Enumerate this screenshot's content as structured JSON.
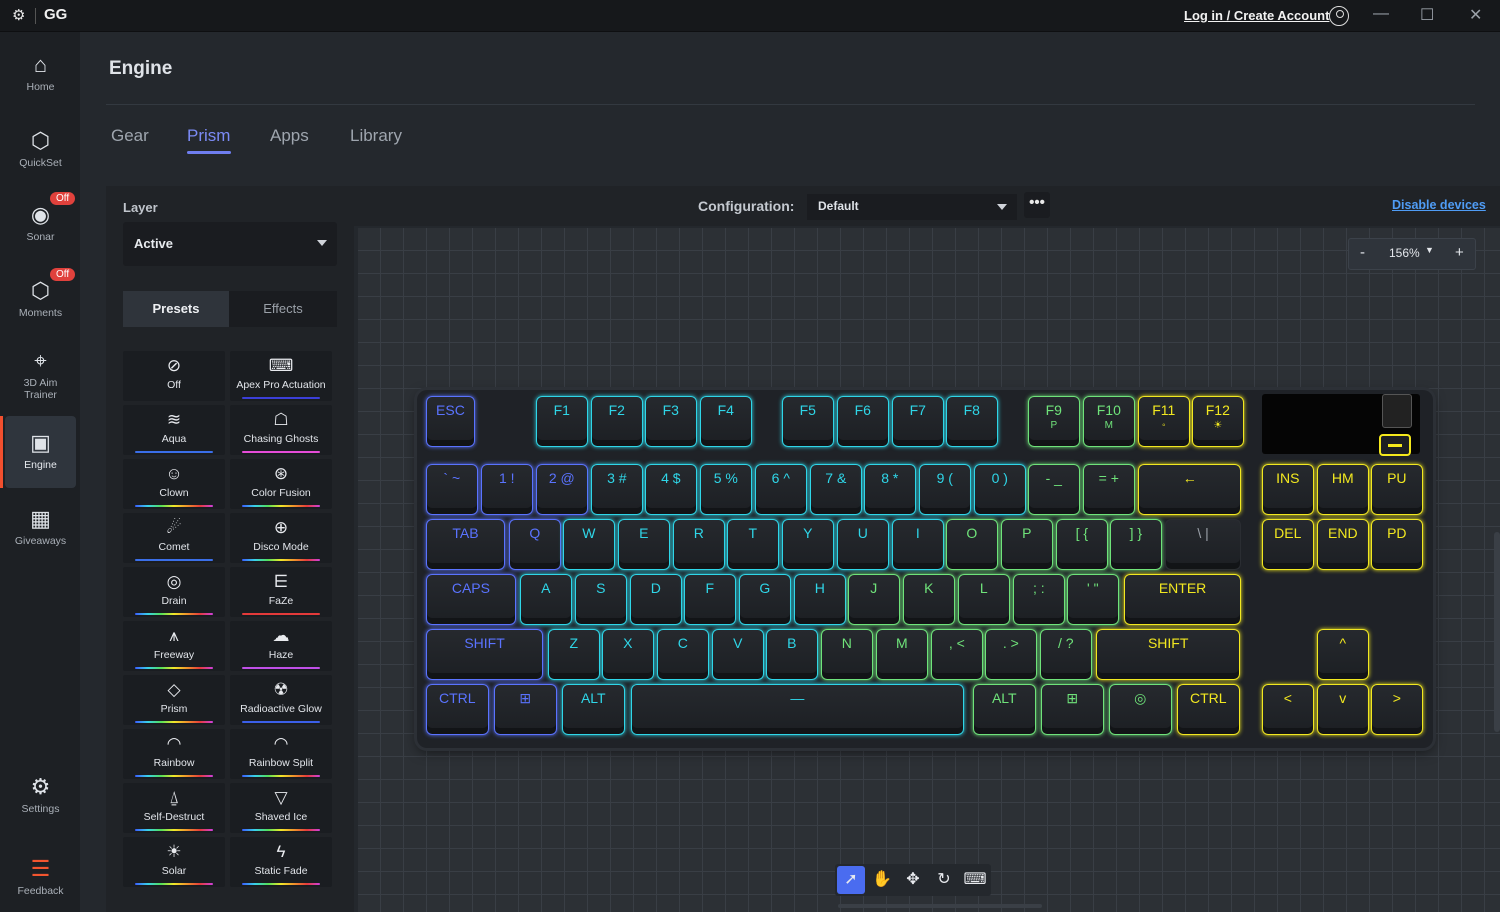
{
  "titlebar": {
    "app": "GG",
    "login": "Log in / Create Account"
  },
  "sidebar": {
    "items": [
      {
        "label": "Home",
        "icon": "home-icon"
      },
      {
        "label": "QuickSet",
        "icon": "quickset-icon"
      },
      {
        "label": "Sonar",
        "icon": "sonar-icon",
        "badge": "Off"
      },
      {
        "label": "Moments",
        "icon": "moments-icon",
        "badge": "Off"
      },
      {
        "label": "3D Aim Trainer",
        "icon": "aim-trainer-icon"
      },
      {
        "label": "Engine",
        "icon": "engine-icon"
      },
      {
        "label": "Giveaways",
        "icon": "giveaways-icon"
      },
      {
        "label": "Settings",
        "icon": "settings-icon"
      },
      {
        "label": "Feedback",
        "icon": "feedback-icon"
      }
    ]
  },
  "page": {
    "title": "Engine",
    "tabs": [
      "Gear",
      "Prism",
      "Apps",
      "Library"
    ],
    "active_tab": "Prism"
  },
  "panel": {
    "layer_label": "Layer",
    "layer_value": "Active",
    "seg_presets": "Presets",
    "seg_effects": "Effects",
    "presets": [
      {
        "label": "Off",
        "icon": "off-icon",
        "bar": ""
      },
      {
        "label": "Apex Pro Actuation",
        "icon": "keyboard-icon",
        "bar": "#3b3fd8"
      },
      {
        "label": "Aqua",
        "icon": "aqua-icon",
        "bar": "#3a6ee8"
      },
      {
        "label": "Chasing Ghosts",
        "icon": "ghost-icon",
        "bar": "#e64cd8"
      },
      {
        "label": "Clown",
        "icon": "clown-icon",
        "bar": "rainbow"
      },
      {
        "label": "Color Fusion",
        "icon": "color-fusion-icon",
        "bar": "rainbow"
      },
      {
        "label": "Comet",
        "icon": "comet-icon",
        "bar": "#3b6fe8"
      },
      {
        "label": "Disco Mode",
        "icon": "disco-icon",
        "bar": "rainbow"
      },
      {
        "label": "Drain",
        "icon": "drain-icon",
        "bar": "rainbow"
      },
      {
        "label": "FaZe",
        "icon": "faze-icon",
        "bar": "#e43a3a"
      },
      {
        "label": "Freeway",
        "icon": "freeway-icon",
        "bar": "rainbow"
      },
      {
        "label": "Haze",
        "icon": "haze-icon",
        "bar": "#c050e8"
      },
      {
        "label": "Prism",
        "icon": "prism-icon",
        "bar": "rainbow"
      },
      {
        "label": "Radioactive Glow",
        "icon": "radioactive-icon",
        "bar": "#3b5fe8"
      },
      {
        "label": "Rainbow",
        "icon": "rainbow-icon",
        "bar": "rainbow"
      },
      {
        "label": "Rainbow Split",
        "icon": "rainbow-split-icon",
        "bar": "rainbow"
      },
      {
        "label": "Self-Destruct",
        "icon": "self-destruct-icon",
        "bar": "rainbow"
      },
      {
        "label": "Shaved Ice",
        "icon": "shaved-ice-icon",
        "bar": "rainbow"
      },
      {
        "label": "Solar",
        "icon": "solar-icon",
        "bar": "rainbow"
      },
      {
        "label": "Static Fade",
        "icon": "static-fade-icon",
        "bar": "rainbow"
      }
    ]
  },
  "config": {
    "label": "Configuration:",
    "value": "Default",
    "disable": "Disable devices"
  },
  "zoom": {
    "minus": "-",
    "value": "156%",
    "plus": "+"
  },
  "keyboard": {
    "colors": {
      "blue": "#5a73ff",
      "cyan": "#2fd6e8",
      "green": "#6fe37a",
      "yellow": "#f2e820"
    },
    "keys": [
      {
        "l": "ESC",
        "c": "blue"
      },
      {
        "l": "F1",
        "c": "cyan"
      },
      {
        "l": "F2",
        "c": "cyan"
      },
      {
        "l": "F3",
        "c": "cyan"
      },
      {
        "l": "F4",
        "c": "cyan"
      },
      {
        "l": "F5",
        "c": "cyan"
      },
      {
        "l": "F6",
        "c": "cyan"
      },
      {
        "l": "F7",
        "c": "cyan"
      },
      {
        "l": "F8",
        "c": "cyan"
      },
      {
        "l": "F9",
        "c": "green",
        "s": "P"
      },
      {
        "l": "F10",
        "c": "green",
        "s": "M"
      },
      {
        "l": "F11",
        "c": "yellow",
        "s": "◦"
      },
      {
        "l": "F12",
        "c": "yellow",
        "s": "☀"
      },
      {
        "l": "` ~",
        "c": "blue"
      },
      {
        "l": "1 !",
        "c": "blue"
      },
      {
        "l": "2 @",
        "c": "blue"
      },
      {
        "l": "3 #",
        "c": "cyan"
      },
      {
        "l": "4 $",
        "c": "cyan"
      },
      {
        "l": "5 %",
        "c": "cyan"
      },
      {
        "l": "6 ^",
        "c": "cyan"
      },
      {
        "l": "7 &",
        "c": "cyan"
      },
      {
        "l": "8 *",
        "c": "cyan"
      },
      {
        "l": "9 (",
        "c": "cyan"
      },
      {
        "l": "0 )",
        "c": "cyan"
      },
      {
        "l": "- _",
        "c": "green"
      },
      {
        "l": "= +",
        "c": "green"
      },
      {
        "l": "←",
        "c": "yellow"
      },
      {
        "l": "INS",
        "c": "yellow"
      },
      {
        "l": "HM",
        "c": "yellow"
      },
      {
        "l": "PU",
        "c": "yellow"
      },
      {
        "l": "TAB",
        "c": "blue"
      },
      {
        "l": "Q",
        "c": "blue"
      },
      {
        "l": "W",
        "c": "cyan"
      },
      {
        "l": "E",
        "c": "cyan"
      },
      {
        "l": "R",
        "c": "cyan"
      },
      {
        "l": "T",
        "c": "cyan"
      },
      {
        "l": "Y",
        "c": "cyan"
      },
      {
        "l": "U",
        "c": "cyan"
      },
      {
        "l": "I",
        "c": "cyan"
      },
      {
        "l": "O",
        "c": "green"
      },
      {
        "l": "P",
        "c": "green"
      },
      {
        "l": "[ {",
        "c": "green"
      },
      {
        "l": "] }",
        "c": "green"
      },
      {
        "l": "\\ |",
        "c": "dark"
      },
      {
        "l": "DEL",
        "c": "yellow"
      },
      {
        "l": "END",
        "c": "yellow"
      },
      {
        "l": "PD",
        "c": "yellow"
      },
      {
        "l": "CAPS",
        "c": "blue"
      },
      {
        "l": "A",
        "c": "cyan"
      },
      {
        "l": "S",
        "c": "cyan"
      },
      {
        "l": "D",
        "c": "cyan"
      },
      {
        "l": "F",
        "c": "cyan"
      },
      {
        "l": "G",
        "c": "cyan"
      },
      {
        "l": "H",
        "c": "cyan"
      },
      {
        "l": "J",
        "c": "green"
      },
      {
        "l": "K",
        "c": "green"
      },
      {
        "l": "L",
        "c": "green"
      },
      {
        "l": "; :",
        "c": "green"
      },
      {
        "l": "' \"",
        "c": "green"
      },
      {
        "l": "ENTER",
        "c": "yellow"
      },
      {
        "l": "SHIFT",
        "c": "blue"
      },
      {
        "l": "Z",
        "c": "cyan"
      },
      {
        "l": "X",
        "c": "cyan"
      },
      {
        "l": "C",
        "c": "cyan"
      },
      {
        "l": "V",
        "c": "cyan"
      },
      {
        "l": "B",
        "c": "cyan"
      },
      {
        "l": "N",
        "c": "green"
      },
      {
        "l": "M",
        "c": "green"
      },
      {
        "l": ", <",
        "c": "green"
      },
      {
        "l": ". >",
        "c": "green"
      },
      {
        "l": "/ ?",
        "c": "green"
      },
      {
        "l": "SHIFT",
        "c": "yellow"
      },
      {
        "l": "^",
        "c": "yellow"
      },
      {
        "l": "CTRL",
        "c": "blue"
      },
      {
        "l": "⊞",
        "c": "blue"
      },
      {
        "l": "ALT",
        "c": "cyan"
      },
      {
        "l": "—",
        "c": "cyan"
      },
      {
        "l": "ALT",
        "c": "green"
      },
      {
        "l": "⊞",
        "c": "green"
      },
      {
        "l": "◎",
        "c": "green"
      },
      {
        "l": "CTRL",
        "c": "yellow"
      },
      {
        "l": "<",
        "c": "yellow"
      },
      {
        "l": "v",
        "c": "yellow"
      },
      {
        "l": ">",
        "c": "yellow"
      }
    ]
  },
  "tools": [
    {
      "icon": "select-arrow-icon"
    },
    {
      "icon": "hand-icon"
    },
    {
      "icon": "move-icon"
    },
    {
      "icon": "rotate-icon"
    },
    {
      "icon": "keyboard-icon"
    }
  ]
}
